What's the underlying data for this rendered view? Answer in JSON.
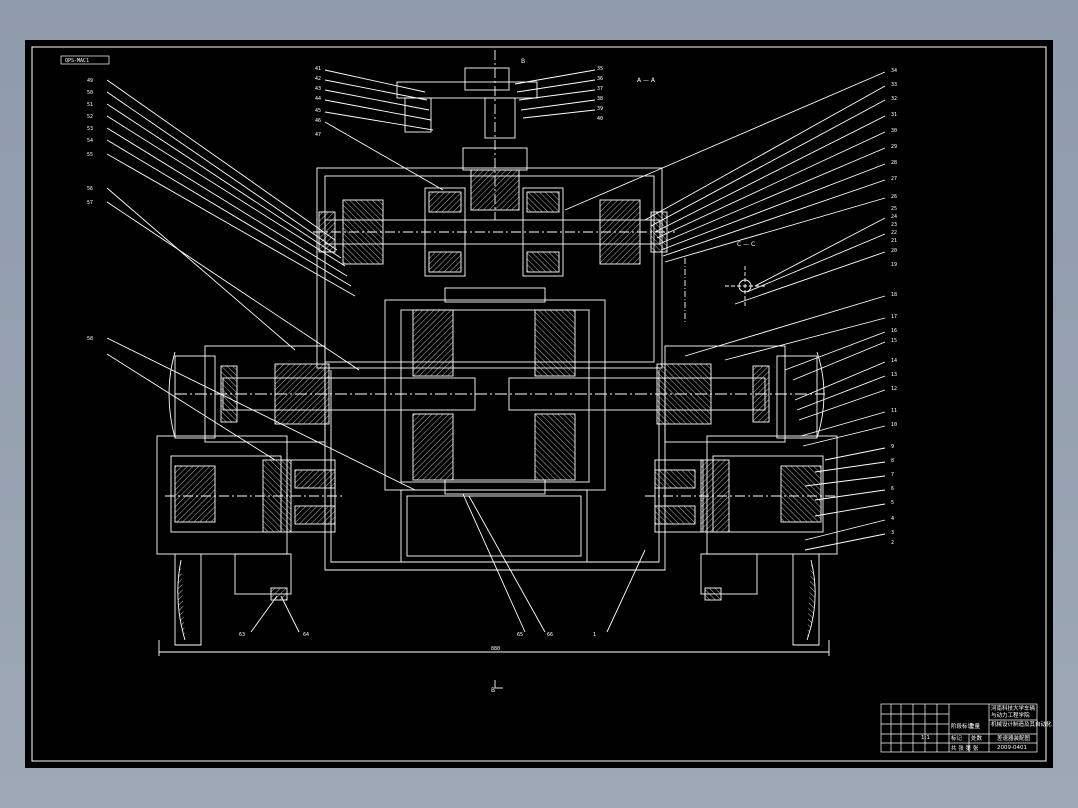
{
  "drawing": {
    "code_box": "QPS-MAC1",
    "section_a": "A — A",
    "section_c": "C — C",
    "marker_b": "B",
    "dim_bottom": "880"
  },
  "left_labels_top": [
    "41",
    "42",
    "43",
    "44",
    "45",
    "46",
    "47"
  ],
  "right_labels_top": [
    "35",
    "36",
    "37",
    "38",
    "39",
    "40"
  ],
  "left_labels": [
    "49",
    "50",
    "51",
    "52",
    "53",
    "54",
    "55",
    "56",
    "57",
    "58"
  ],
  "right_labels": [
    "34",
    "33",
    "32",
    "31",
    "30",
    "29",
    "28",
    "27",
    "26",
    "25",
    "24",
    "23",
    "22",
    "21",
    "20",
    "19",
    "18",
    "17",
    "16",
    "15",
    "14",
    "13",
    "12",
    "11",
    "10",
    "9",
    "8",
    "7",
    "6",
    "5",
    "4",
    "3",
    "2"
  ],
  "bottom_labels": [
    "63",
    "64",
    "65",
    "66",
    "1"
  ],
  "title_block": {
    "school": "河南科技大学车辆",
    "line2": "与动力工程学院",
    "line3": "机械设计制造及其自动化",
    "drawing_name": "差速器装配图",
    "drawing_no": "2009-0401",
    "cells": [
      "标记",
      "处数",
      "分区",
      "更改文件号",
      "签名",
      "年月日"
    ],
    "stage_labels": [
      "阶段标记",
      "重量",
      "比例"
    ],
    "sheet": "共 张  第 张",
    "scale": "1:1"
  },
  "colors": {
    "background": "#000000",
    "lines": "#ffffff",
    "hatch": "#ffffff",
    "window_bg": "#94a0b0"
  }
}
